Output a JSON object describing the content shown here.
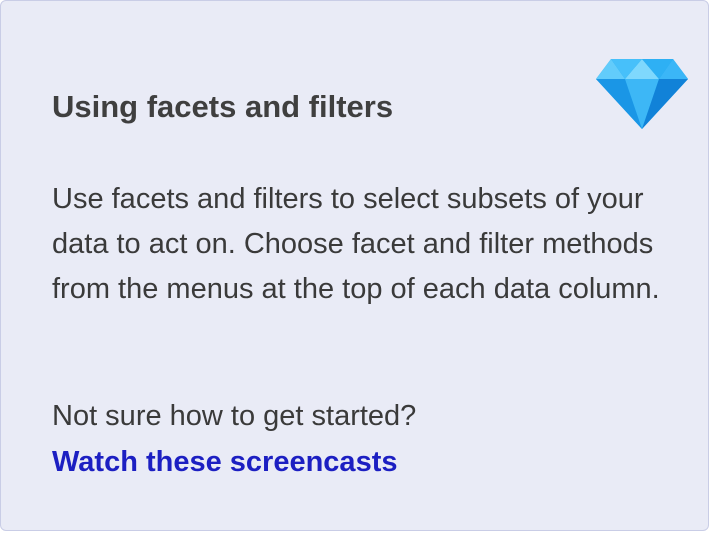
{
  "panel": {
    "title": "Using facets and filters",
    "body": "Use facets and filters to select subsets of your data to act on. Choose facet and filter methods from the menus at the top of each data column.",
    "question": "Not sure how to get started?",
    "link_label": "Watch these screencasts",
    "icon": "diamond-icon"
  },
  "colors": {
    "panel_background": "#e9ebf6",
    "link": "#1c1fc2",
    "gem": "#20a8f0"
  }
}
